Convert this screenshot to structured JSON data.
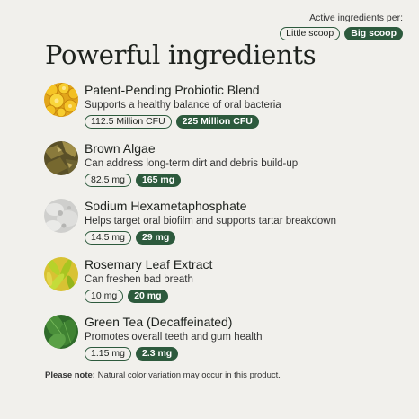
{
  "header": {
    "per_label": "Active ingredients per:",
    "little_scoop": "Little scoop",
    "big_scoop": "Big scoop",
    "title": "Powerful ingredients"
  },
  "ingredients": [
    {
      "name": "Patent-Pending Probiotic Blend",
      "desc": "Supports a healthy balance of oral bacteria",
      "little": "112.5 Million CFU",
      "big": "225 Million CFU",
      "image": "yellow-probiotic-spheres"
    },
    {
      "name": "Brown Algae",
      "desc": "Can address long-term dirt and debris build-up",
      "little": "82.5 mg",
      "big": "165 mg",
      "image": "brown-algae"
    },
    {
      "name": "Sodium Hexametaphosphate",
      "desc": "Helps target oral biofilm and supports tartar breakdown",
      "little": "14.5 mg",
      "big": "29 mg",
      "image": "white-powder"
    },
    {
      "name": "Rosemary Leaf Extract",
      "desc": "Can freshen bad breath",
      "little": "10 mg",
      "big": "20 mg",
      "image": "rosemary-leaves"
    },
    {
      "name": "Green Tea (Decaffeinated)",
      "desc": "Promotes overall teeth and gum health",
      "little": "1.15 mg",
      "big": "2.3 mg",
      "image": "green-tea-leaves"
    }
  ],
  "note": {
    "label": "Please note:",
    "text": " Natural color variation may occur in this product."
  },
  "colors": {
    "background": "#f1f0ec",
    "accent_green": "#2d5a3d"
  }
}
